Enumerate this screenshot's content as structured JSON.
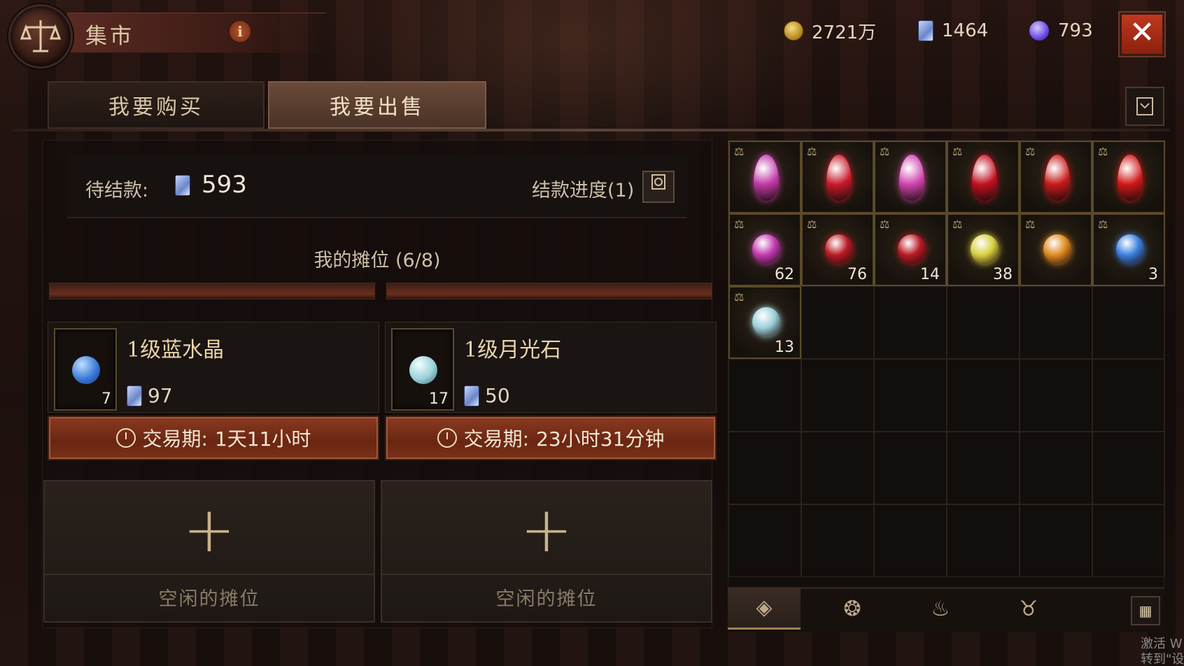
{
  "header": {
    "title": "集市",
    "info_label": "i",
    "currencies": [
      {
        "name": "gold",
        "value": "2721万",
        "color": "#e0b040"
      },
      {
        "name": "scroll",
        "value": "1464",
        "color": "#8aa6e8"
      },
      {
        "name": "orb",
        "value": "793",
        "color": "#7a5ae8"
      }
    ],
    "close_label": "✕"
  },
  "tabs": [
    {
      "label": "我要购买",
      "active": false
    },
    {
      "label": "我要出售",
      "active": true
    }
  ],
  "pending": {
    "label": "待结款:",
    "value": "593",
    "progress_label": "结款进度(1)"
  },
  "stall": {
    "title": "我的摊位 (6/8)",
    "listings": [
      {
        "name": "1级蓝水晶",
        "count": "7",
        "price": "97",
        "period_label": "交易期:",
        "period_value": "1天11小时",
        "gem_color": "#3a7ad8"
      },
      {
        "name": "1级月光石",
        "count": "17",
        "price": "50",
        "period_label": "交易期:",
        "period_value": "23小时31分钟",
        "gem_color": "#9ad0d8"
      }
    ],
    "empty_slots": [
      {
        "plus": "+",
        "label": "空闲的摊位"
      },
      {
        "plus": "+",
        "label": "空闲的摊位"
      }
    ]
  },
  "inventory": [
    {
      "row": 0,
      "col": 0,
      "color": "#c03aa8",
      "count": ""
    },
    {
      "row": 0,
      "col": 1,
      "color": "#c81a2a",
      "count": ""
    },
    {
      "row": 0,
      "col": 2,
      "color": "#d044b0",
      "count": ""
    },
    {
      "row": 0,
      "col": 3,
      "color": "#c01020",
      "count": ""
    },
    {
      "row": 0,
      "col": 4,
      "color": "#c81a1a",
      "count": ""
    },
    {
      "row": 0,
      "col": 5,
      "color": "#d01818",
      "count": ""
    },
    {
      "row": 1,
      "col": 0,
      "color": "#c23ab0",
      "count": "62"
    },
    {
      "row": 1,
      "col": 1,
      "color": "#b81a24",
      "count": "76"
    },
    {
      "row": 1,
      "col": 2,
      "color": "#b81a24",
      "count": "14"
    },
    {
      "row": 1,
      "col": 3,
      "color": "#d8d040",
      "count": "38"
    },
    {
      "row": 1,
      "col": 4,
      "color": "#e08a20",
      "count": ""
    },
    {
      "row": 1,
      "col": 5,
      "color": "#3a80e0",
      "count": "3"
    },
    {
      "row": 2,
      "col": 0,
      "color": "#9ad0d8",
      "count": "13"
    }
  ],
  "bottom_tabs": [
    {
      "name": "gem-tab-icon",
      "glyph": "◈",
      "active": true
    },
    {
      "name": "rune-tab-icon",
      "glyph": "❂",
      "active": false
    },
    {
      "name": "bag-tab-icon",
      "glyph": "♨",
      "active": false
    },
    {
      "name": "demon-tab-icon",
      "glyph": "♉",
      "active": false
    }
  ],
  "grid_toggle_glyph": "▦",
  "watermark": {
    "line1": "激活 W",
    "line2": "转到\"设置"
  }
}
